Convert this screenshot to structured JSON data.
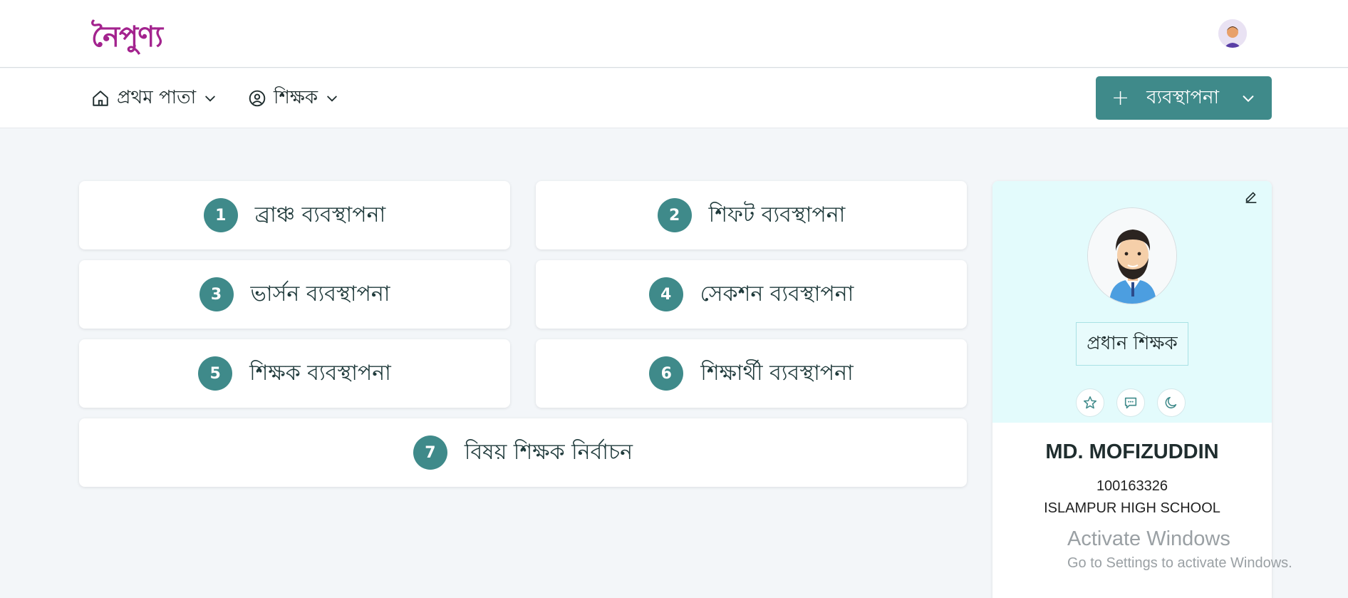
{
  "header": {
    "logo_text": "নৈপুণ্য",
    "brand_color": "#a3238e"
  },
  "nav": {
    "home_label": "প্রথম পাতা",
    "teacher_label": "শিক্ষক",
    "manage_label": "ব্যবস্থাপনা",
    "accent": "#3f8a8a"
  },
  "cards": [
    {
      "num": "1",
      "label": "ব্রাঞ্চ ব্যবস্থাপনা"
    },
    {
      "num": "2",
      "label": "শিফট ব্যবস্থাপনা"
    },
    {
      "num": "3",
      "label": "ভার্সন ব্যবস্থাপনা"
    },
    {
      "num": "4",
      "label": "সেকশন ব্যবস্থাপনা"
    },
    {
      "num": "5",
      "label": "শিক্ষক ব্যবস্থাপনা"
    },
    {
      "num": "6",
      "label": "শিক্ষার্থী ব্যবস্থাপনা"
    },
    {
      "num": "7",
      "label": "বিষয় শিক্ষক নির্বাচন"
    }
  ],
  "profile": {
    "role": "প্রধান শিক্ষক",
    "name": "MD. MOFIZUDDIN",
    "id": "100163326",
    "school": "ISLAMPUR HIGH SCHOOL",
    "icons": [
      "star-icon",
      "chat-icon",
      "moon-icon",
      "edit-icon"
    ]
  },
  "watermark": {
    "line1": "Activate Windows",
    "line2": "Go to Settings to activate Windows."
  }
}
